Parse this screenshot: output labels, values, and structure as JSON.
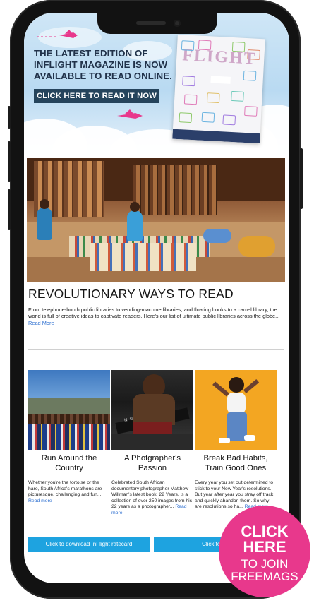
{
  "hero": {
    "headline_line1": "THE LATEST EDITION OF",
    "headline_line2": "INFLIGHT MAGAZINE IS NOW",
    "headline_line3": "AVAILABLE TO READ ONLINE.",
    "cta_label": "CLICK HERE TO READ IT NOW",
    "magazine_cover_title": "FLIGHT"
  },
  "feature": {
    "title": "REVOLUTIONARY WAYS TO READ",
    "body": "From telephone-booth public libraries to vending-machine libraries, and floating books to a camel library, the world is full of creative ideas to captivate readers. Here's our list of ultimate public libraries across the globe...",
    "read_more": "Read More"
  },
  "cards": [
    {
      "title": "Run Around the Country",
      "body": "Whether you're the tortoise or the hare, South Africa's marathons are picturesque, challenging and fun...",
      "read_more": "Read more"
    },
    {
      "title": "A Photgrapher's Passion",
      "body": "Celebrated South African documentary photographer Matthew Willman's latest book, 22 Years, is a collection of over 250 images from his 22 years as a photographer...",
      "read_more": "Read more"
    },
    {
      "title": "Break Bad Habits, Train Good Ones",
      "body": "Every year you set out determined to stick to your New Year's resolutions. But year after year you stray off track and quickly abandon them. So why are resolutions so ha...",
      "read_more": "Read more"
    }
  ],
  "cta_buttons": {
    "ratecard": "Click to download InFlight ratecard",
    "sales": "Click for sales"
  },
  "badge": {
    "line1": "CLICK",
    "line2": "HERE",
    "line3": "TO JOIN",
    "line4": "FREEMAGS"
  },
  "colors": {
    "accent_pink": "#e8388c",
    "cta_blue": "#1ea3e0",
    "hero_button": "#25445c",
    "link_blue": "#2d6fd0"
  },
  "icons": [
    "pink-plane-icon",
    "pink-plane-icon"
  ]
}
